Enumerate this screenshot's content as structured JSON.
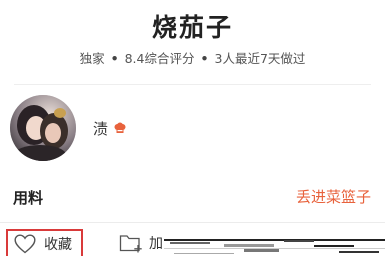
{
  "recipe": {
    "title": "烧茄子",
    "meta": {
      "tag": "独家",
      "rating": "8.4综合评分",
      "recent": "3人最近7天做过"
    }
  },
  "author": {
    "name": "渍",
    "badge_icon": "chef-hat-icon",
    "avatar_icon": "avatar-photo"
  },
  "ingredients": {
    "section_title": "用料",
    "basket_link": "丢进菜篮子"
  },
  "toolbar": {
    "favorite_label": "收藏",
    "favorite_icon": "heart-outline-icon",
    "add_label": "加",
    "add_icon": "folder-add-icon"
  },
  "colors": {
    "accent": "#e8623c",
    "highlight_border": "#d93a3a"
  }
}
